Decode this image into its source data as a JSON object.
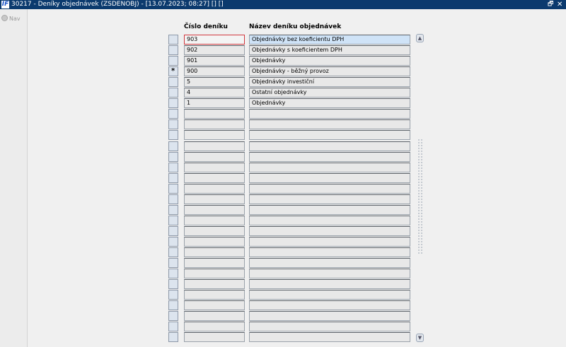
{
  "window": {
    "app_icon_label": "IF",
    "title": "30217 - Deníky objednávek (ZSDENOBJ) - [13.07.2023; 08:27] [] []",
    "restore_glyph": "🗗",
    "close_glyph": "✕"
  },
  "nav": {
    "label": "Nav"
  },
  "columns": {
    "number": "Číslo deníku",
    "name": "Název deníku objednávek"
  },
  "current_row_marker": "*",
  "rows": [
    {
      "number": "903",
      "name": "Objednávky bez koeficientu DPH",
      "marker": ""
    },
    {
      "number": "902",
      "name": "Objednávky s koeficientem DPH",
      "marker": ""
    },
    {
      "number": "901",
      "name": "Objednávky",
      "marker": ""
    },
    {
      "number": "900",
      "name": "Objednávky - běžný provoz",
      "marker": "*"
    },
    {
      "number": "5",
      "name": "Objednávky investiční",
      "marker": ""
    },
    {
      "number": "4",
      "name": "Ostatní objednávky",
      "marker": ""
    },
    {
      "number": "1",
      "name": "Objednávky",
      "marker": ""
    }
  ],
  "visible_row_count": 29,
  "scroll": {
    "up_glyph": "▲",
    "down_glyph": "▼"
  },
  "colors": {
    "titlebar": "#0b3a6e",
    "current_field_border": "#d0363c",
    "active_name_bg": "#cfe3f7"
  }
}
